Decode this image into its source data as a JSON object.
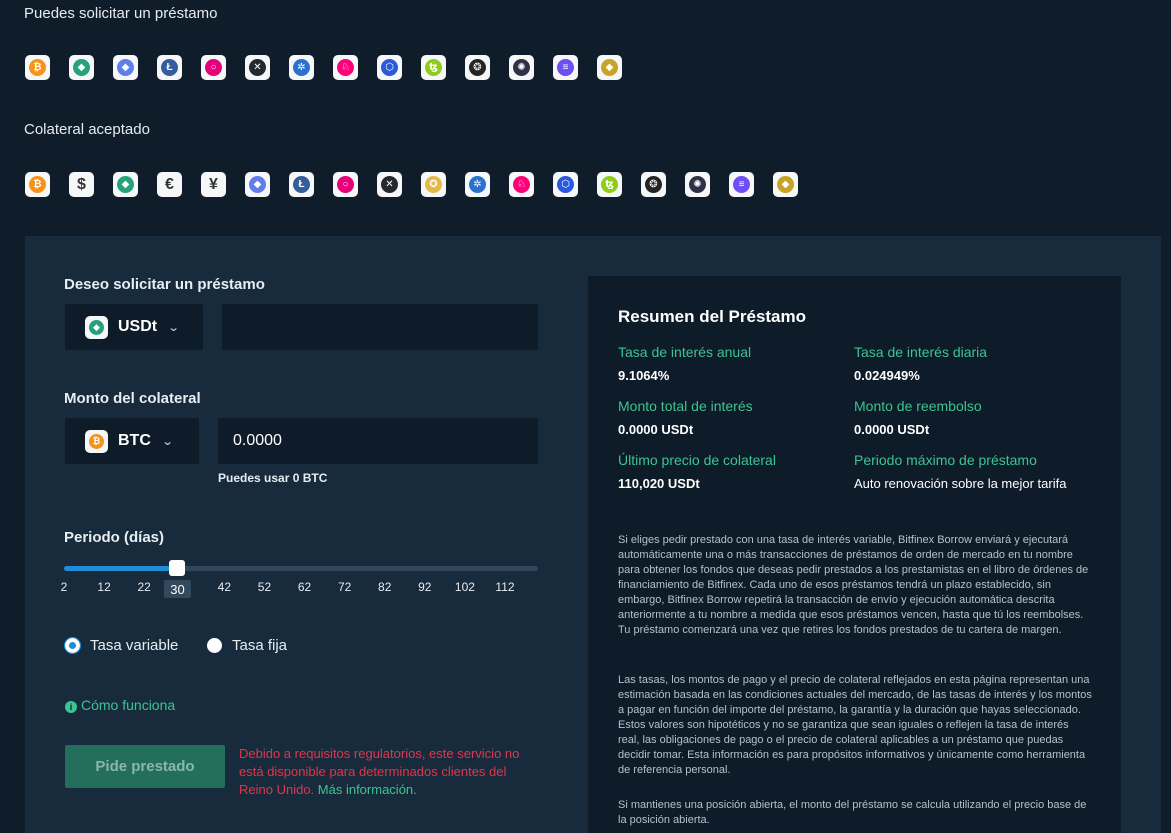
{
  "borrowable": {
    "title": "Puedes solicitar un préstamo",
    "coins": [
      {
        "icon": "bitcoin-icon",
        "glyph": "₿",
        "color": "#f7931a"
      },
      {
        "icon": "tether-icon",
        "glyph": "◆",
        "color": "#26a17b"
      },
      {
        "icon": "ethereum-icon",
        "glyph": "◆",
        "color": "#627eea"
      },
      {
        "icon": "litecoin-icon",
        "glyph": "Ł",
        "color": "#345d9d"
      },
      {
        "icon": "polkadot-icon",
        "glyph": "○",
        "color": "#e6007a"
      },
      {
        "icon": "xrp-icon",
        "glyph": "✕",
        "color": "#23292f"
      },
      {
        "icon": "cardano-icon",
        "glyph": "✲",
        "color": "#2a71d0"
      },
      {
        "icon": "uniswap-icon",
        "glyph": "♘",
        "color": "#ff007a"
      },
      {
        "icon": "chainlink-icon",
        "glyph": "⬡",
        "color": "#2a5ada"
      },
      {
        "icon": "tezos-icon",
        "glyph": "ꜩ",
        "color": "#8fcc1c"
      },
      {
        "icon": "iota-icon",
        "glyph": "❂",
        "color": "#242424"
      },
      {
        "icon": "cosmos-icon",
        "glyph": "✺",
        "color": "#2e3148"
      },
      {
        "icon": "solana-icon",
        "glyph": "≡",
        "color": "#6e4ff2"
      },
      {
        "icon": "xaut-icon",
        "glyph": "◆",
        "color": "#c9a227"
      }
    ]
  },
  "collateral": {
    "title": "Colateral aceptado",
    "coins": [
      {
        "icon": "bitcoin-icon",
        "glyph": "₿",
        "color": "#f7931a"
      },
      {
        "icon": "dollar-icon",
        "glyph": "$",
        "color": "#ffffff"
      },
      {
        "icon": "tether-icon",
        "glyph": "◆",
        "color": "#26a17b"
      },
      {
        "icon": "euro-icon",
        "glyph": "€",
        "color": "#ffffff"
      },
      {
        "icon": "yen-icon",
        "glyph": "¥",
        "color": "#ffffff"
      },
      {
        "icon": "ethereum-icon",
        "glyph": "◆",
        "color": "#627eea"
      },
      {
        "icon": "litecoin-icon",
        "glyph": "Ł",
        "color": "#345d9d"
      },
      {
        "icon": "polkadot-icon",
        "glyph": "○",
        "color": "#e6007a"
      },
      {
        "icon": "xrp-icon",
        "glyph": "✕",
        "color": "#23292f"
      },
      {
        "icon": "pax-gold-icon",
        "glyph": "✪",
        "color": "#e4b94a"
      },
      {
        "icon": "cardano-icon",
        "glyph": "✲",
        "color": "#2a71d0"
      },
      {
        "icon": "uniswap-icon",
        "glyph": "♘",
        "color": "#ff007a"
      },
      {
        "icon": "chainlink-icon",
        "glyph": "⬡",
        "color": "#2a5ada"
      },
      {
        "icon": "tezos-icon",
        "glyph": "ꜩ",
        "color": "#8fcc1c"
      },
      {
        "icon": "iota-icon",
        "glyph": "❂",
        "color": "#242424"
      },
      {
        "icon": "cosmos-icon",
        "glyph": "✺",
        "color": "#2e3148"
      },
      {
        "icon": "solana-icon",
        "glyph": "≡",
        "color": "#6e4ff2"
      },
      {
        "icon": "xaut-icon",
        "glyph": "◆",
        "color": "#c9a227"
      }
    ]
  },
  "form": {
    "borrow_label": "Deseo solicitar un préstamo",
    "borrow_currency": "USDt",
    "borrow_amount": "",
    "collateral_label": "Monto del colateral",
    "collateral_currency": "BTC",
    "collateral_amount": "0.0000",
    "available_hint": "Puedes usar 0 BTC",
    "period_label": "Periodo (días)",
    "period_ticks": [
      "2",
      "12",
      "22",
      "42",
      "52",
      "62",
      "72",
      "82",
      "92",
      "102",
      "112"
    ],
    "period_current": "30",
    "period_fraction": 0.236,
    "rate_variable": "Tasa variable",
    "rate_fixed": "Tasa fija",
    "rate_selected": "variable",
    "how_it_works": "Cómo funciona",
    "borrow_button": "Pide prestado",
    "warning": "Debido a requisitos regulatorios, este servicio no está disponible para determinados clientes del Reino Unido.",
    "more_info": "Más información."
  },
  "summary": {
    "title": "Resumen del Préstamo",
    "annual_rate_label": "Tasa de interés anual",
    "annual_rate": "9.1064%",
    "daily_rate_label": "Tasa de interés diaria",
    "daily_rate": "0.024949%",
    "total_interest_label": "Monto total de interés",
    "total_interest": "0.0000 USDt",
    "repayment_label": "Monto de reembolso",
    "repayment": "0.0000 USDt",
    "last_price_label": "Último precio de colateral",
    "last_price": "110,020 USDt",
    "max_period_label": "Periodo máximo de préstamo",
    "max_period": "Auto renovación sobre la mejor tarifa",
    "para1": "Si eliges pedir prestado con una tasa de interés variable, Bitfinex Borrow enviará y ejecutará automáticamente una o más transacciones de préstamos de orden de mercado en tu nombre para obtener los fondos que deseas pedir prestados a los prestamistas en el libro de órdenes de financiamiento de Bitfinex. Cada uno de esos préstamos tendrá un plazo establecido, sin embargo, Bitfinex Borrow repetirá la transacción de envío y ejecución automática descrita anteriormente a tu nombre a medida que esos préstamos vencen, hasta que tú los reembolses. Tu préstamo comenzará una vez que retires los fondos prestados de tu cartera de margen.",
    "para2": "Las tasas, los montos de pago y el precio de colateral reflejados en esta página representan una estimación basada en las condiciones actuales del mercado, de las tasas de interés y los montos a pagar en función del importe del préstamo, la garantía y la duración que hayas seleccionado. Estos valores son hipotéticos y no se garantiza que sean iguales o reflejen la tasa de interés real, las obligaciones de pago o el precio de colateral aplicables a un préstamo que puedas decidir tomar. Esta información es para propósitos informativos y únicamente como herramienta de referencia personal.",
    "para3": "Si mantienes una posición abierta, el monto del préstamo se calcula utilizando el precio base de la posición abierta."
  }
}
